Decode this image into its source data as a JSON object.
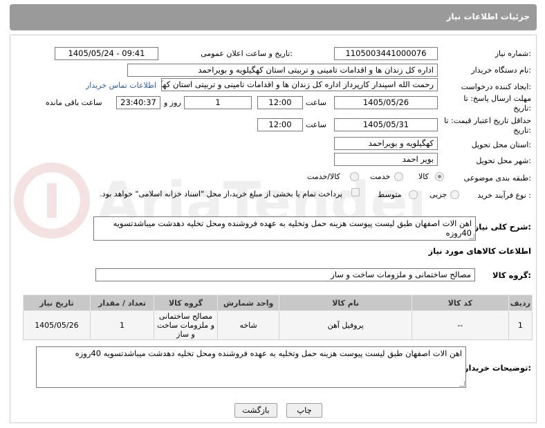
{
  "header": {
    "title": "جزئیات اطلاعات نیاز"
  },
  "form": {
    "need_number_label": "شماره نیاز:",
    "need_number": "1105003441000076",
    "announce_label": "تاریخ و ساعت اعلان عمومی:",
    "announce_value": "1405/05/24 - 09:41",
    "buyer_org_label": "نام دستگاه خریدار:",
    "buyer_org": "اداره کل زندان ها و اقدامات تامینی و تربیتی استان کهگیلویه و بویراحمد",
    "creator_label": "ایجاد کننده درخواست:",
    "creator": "رحمت الله اسپندار کارپرداز اداره کل زندان ها و اقدامات تامینی و تربیتی استان کهگیلویه و بویراحمد",
    "contact_link": "اطلاعات تماس خریدار",
    "reply_deadline_label": "مهلت ارسال پاسخ: تا تاریخ:",
    "reply_date": "1405/05/26",
    "time_label": "ساعت",
    "reply_time": "12:00",
    "days_value": "1",
    "days_label": "روز و",
    "remaining_time": "23:40:37",
    "remaining_label": "ساعت باقی مانده",
    "price_deadline_label": "حداقل تاریخ اعتبار قیمت: تا تاریخ:",
    "price_date": "1405/05/31",
    "price_time": "12:00",
    "province_label": "استان محل تحویل:",
    "province": "کهگیلویه و بویراحمد",
    "city_label": "شهر محل تحویل:",
    "city": "بویر احمد",
    "category_label": "طبقه بندی موضوعی:",
    "category_options": [
      "کالا",
      "خدمت",
      "کالا/خدمت"
    ],
    "category_selected": "کالا",
    "process_label": "نوع فرآیند خرید :",
    "process_options": [
      "جزیی",
      "متوسط"
    ],
    "payment_note": "پرداخت تمام یا بخشی از مبلغ خرید،از محل \"اسناد خزانه اسلامی\" خواهد بود."
  },
  "description": {
    "label": "شرح کلی نیاز:",
    "text": "اهن الات اصفهان طبق لیست پیوست هزینه حمل  وتخلیه به عهده فروشنده ومحل تخلیه دهدشت میباشدتسویه 40روزه"
  },
  "goods": {
    "section_title": "اطلاعات کالاهای مورد نیاز",
    "group_label": "گروه کالا:",
    "group_value": "مصالح ساختمانی و ملزومات ساخت و ساز",
    "columns": [
      "ردیف",
      "کد کالا",
      "نام کالا",
      "واحد شمارش",
      "گروه کالا",
      "تعداد / مقدار",
      "تاریخ نیاز"
    ],
    "rows": [
      [
        "1",
        "--",
        "پروفیل آهن",
        "شاخه",
        "مصالح ساختمانی و ملزومات ساخت و ساز",
        "1",
        "1405/05/26"
      ]
    ]
  },
  "buyer_notes": {
    "label": "توضیحات خریدار:",
    "text": "اهن الات اصفهان طبق لیست پیوست هزینه حمل  وتخلیه به عهده فروشنده ومحل تخلیه دهدشت میباشدتسویه 40روزه"
  },
  "actions": {
    "print": "چاپ",
    "back": "بازگشت"
  },
  "watermark": {
    "text": "AriaTender.net"
  }
}
